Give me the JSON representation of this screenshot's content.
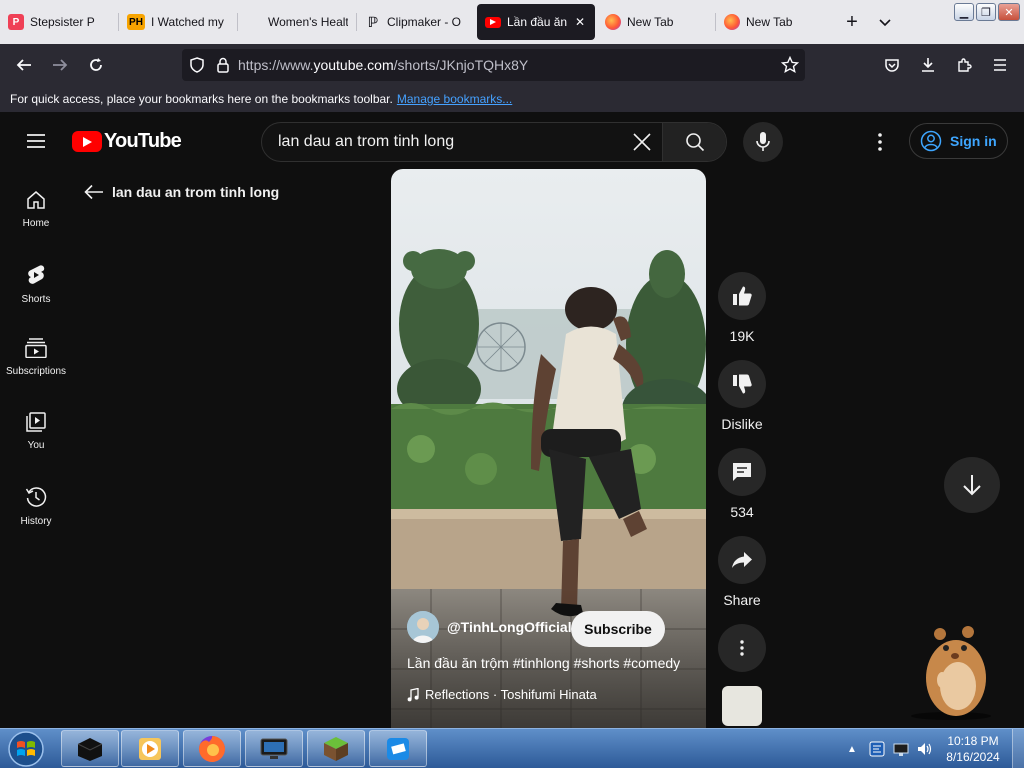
{
  "browser": {
    "tabs": [
      {
        "title": "Stepsister P",
        "favicon": "pocket-icon",
        "active": false
      },
      {
        "title": "I Watched my",
        "favicon": "ph-icon",
        "active": false
      },
      {
        "title": "Women's Health -",
        "favicon": "blank-icon",
        "active": false
      },
      {
        "title": "Clipmaker - O",
        "favicon": "clipmaker-icon",
        "active": false
      },
      {
        "title": "Lần đầu ăn",
        "favicon": "youtube-icon",
        "active": true
      },
      {
        "title": "New Tab",
        "favicon": "firefox-icon",
        "active": false
      },
      {
        "title": "New Tab",
        "favicon": "firefox-icon",
        "active": false
      }
    ],
    "url_prefix": "https://www.",
    "url_domain": "youtube.com",
    "url_path": "/shorts/JKnjoTQHx8Y",
    "bookmarks_message": "For quick access, place your bookmarks here on the bookmarks toolbar.",
    "bookmarks_link": "Manage bookmarks..."
  },
  "youtube": {
    "logo_text": "YouTube",
    "search_value": "lan dau an trom tinh long",
    "sign_in": "Sign in",
    "guide": [
      {
        "label": "Home",
        "icon": "home-icon"
      },
      {
        "label": "Shorts",
        "icon": "shorts-icon"
      },
      {
        "label": "Subscriptions",
        "icon": "subscriptions-icon"
      },
      {
        "label": "You",
        "icon": "you-icon"
      },
      {
        "label": "History",
        "icon": "history-icon"
      }
    ],
    "back_title": "lan dau an trom tinh long",
    "short": {
      "channel": "@TinhLongOfficial",
      "subscribe": "Subscribe",
      "title": "Lần đầu ăn trộm #tinhlong #shorts #comedy",
      "music": "Reflections · Toshifumi Hinata",
      "likes": "19K",
      "dislike": "Dislike",
      "comments": "534",
      "share": "Share"
    }
  },
  "taskbar": {
    "time": "10:18 PM",
    "date": "8/16/2024"
  },
  "colors": {
    "yt_bg": "#0f0f0f",
    "yt_red": "#ff0000",
    "link_blue": "#3ea6ff",
    "firefox_dark": "#2b2a33"
  }
}
